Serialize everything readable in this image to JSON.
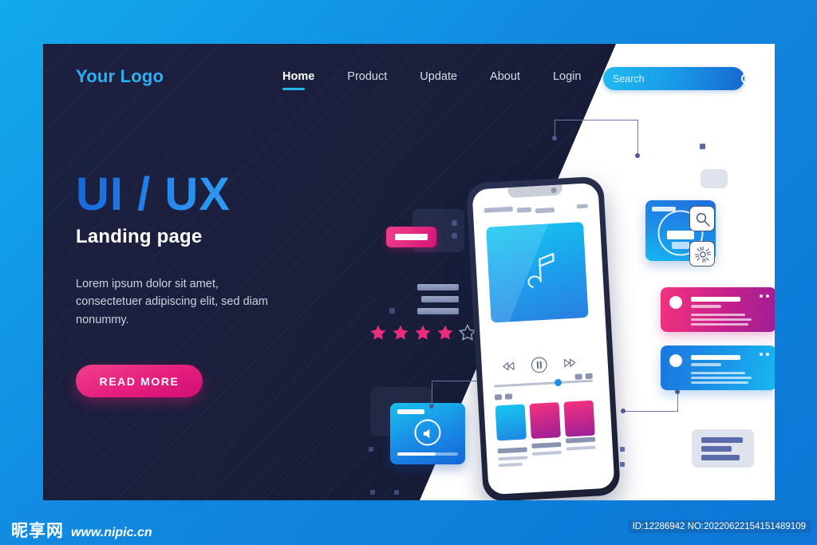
{
  "site": {
    "logo": "Your Logo"
  },
  "nav": {
    "items": [
      {
        "label": "Home",
        "active": true
      },
      {
        "label": "Product",
        "active": false
      },
      {
        "label": "Update",
        "active": false
      },
      {
        "label": "About",
        "active": false
      },
      {
        "label": "Login",
        "active": false
      }
    ]
  },
  "search": {
    "value": "",
    "placeholder": "Search",
    "icon": "search-icon"
  },
  "hero": {
    "title": "UI / UX",
    "subtitle": "Landing page",
    "body": "Lorem ipsum dolor sit amet, consectetuer adipiscing elit, sed diam nonummy.",
    "cta_label": "READ MORE"
  },
  "illustration": {
    "rating": {
      "filled": 4,
      "total": 5
    },
    "phone": {
      "album_icon": "music-note-icon",
      "controls": [
        {
          "name": "rewind-icon",
          "glyph": "◁◁"
        },
        {
          "name": "play-pause-icon",
          "glyph": "❘❘"
        },
        {
          "name": "fast-forward-icon",
          "glyph": "▷▷"
        }
      ],
      "progress_percent": 61,
      "thumbnails": [
        "thumb-blue",
        "thumb-pink-1",
        "thumb-pink-2"
      ]
    },
    "side_icons": [
      {
        "name": "search-icon"
      },
      {
        "name": "brightness-icon"
      }
    ],
    "video_card": {
      "icon": "speaker-icon",
      "progress_percent": 63
    },
    "cards": [
      {
        "name": "window-blue-card"
      },
      {
        "name": "message-card-pink"
      },
      {
        "name": "message-card-blue"
      },
      {
        "name": "gray-list-card"
      }
    ]
  },
  "colors": {
    "page_blue": "#0d8ee0",
    "dark_panel": "#1b2040",
    "accent_cyan": "#23b7f0",
    "accent_blue": "#1668d8",
    "accent_pink": "#e51e7e",
    "logo_blue": "#2bb2f5"
  },
  "footer": {
    "watermark_cn": "昵享网",
    "watermark_url": "www.nipic.cn",
    "id_tag": "ID:12286942 NO:20220622154151489109"
  }
}
